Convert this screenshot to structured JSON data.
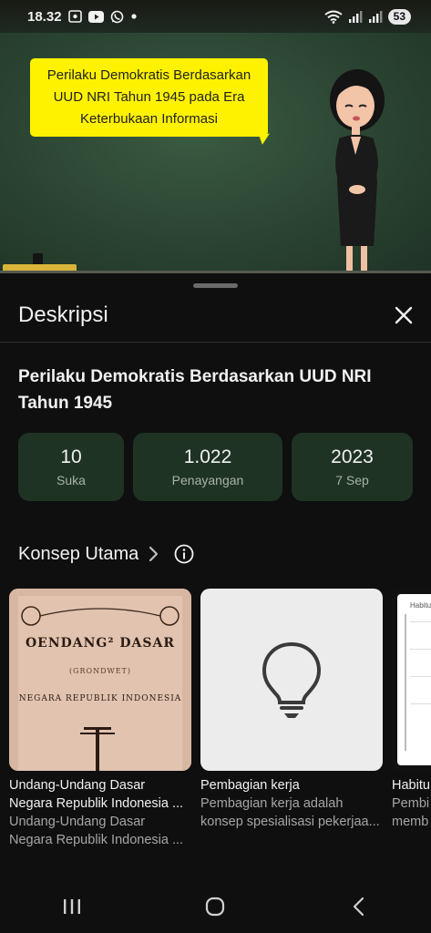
{
  "status_bar": {
    "time": "18.32",
    "battery": "53",
    "left_icons": [
      "screen-record-icon",
      "youtube-icon",
      "whatsapp-icon",
      "dot-icon"
    ],
    "right_icons": [
      "wifi-icon",
      "signal-icon",
      "signal-icon"
    ]
  },
  "video": {
    "bubble_line1": "Perilaku Demokratis Berdasarkan",
    "bubble_line2": "UUD NRI Tahun 1945 pada Era",
    "bubble_line3": "Keterbukaan Informasi",
    "board_color": "#2e4a36",
    "bubble_color": "#fff200"
  },
  "sheet": {
    "title": "Deskripsi",
    "close_icon": "close-icon",
    "video_title": "Perilaku Demokratis Berdasarkan UUD NRI Tahun 1945",
    "stats": [
      {
        "value": "10",
        "label": "Suka"
      },
      {
        "value": "1.022",
        "label": "Penayangan"
      },
      {
        "value": "2023",
        "label": "7 Sep"
      }
    ],
    "stat_bg": "#1f3324"
  },
  "concepts": {
    "title": "Konsep Utama",
    "cards": [
      {
        "thumb_line1": "OENDANG² DASAR",
        "thumb_line2": "(GRONDWET)",
        "thumb_line3": "NEGARA REPUBLIK INDONESIA",
        "title_line1": "Undang-Undang Dasar",
        "title_line2": "Negara Republik Indonesia ...",
        "desc_line1": "Undang-Undang Dasar",
        "desc_line2": "Negara Republik Indonesia ..."
      },
      {
        "title_line1": "Pembagian kerja",
        "desc_line1": "Pembagian kerja adalah",
        "desc_line2": "konsep spesialisasi pekerjaa..."
      },
      {
        "thumb_head": "Habitus",
        "title_line1": "Habitu",
        "desc_line1": "Pembi",
        "desc_line2": "memb"
      }
    ]
  },
  "nav_bar": {
    "icons": [
      "recent-apps-icon",
      "home-icon",
      "back-icon"
    ]
  }
}
